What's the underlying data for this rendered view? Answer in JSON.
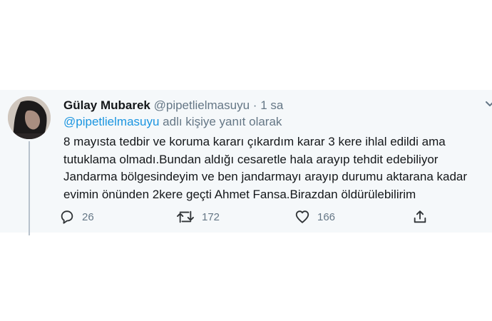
{
  "tweet": {
    "display_name": "Gülay Mubarek",
    "handle": "@pipetlielmasuyu",
    "separator": "·",
    "time": "1 sa",
    "reply_mention": "@pipetlielmasuyu",
    "reply_suffix": "adlı kişiye yanıt olarak",
    "body_lines": [
      "8 mayısta tedbir ve koruma kararı çıkardım karar 3 kere ihlal edildi ama",
      "tutuklama olmadı.Bundan aldığı cesaretle hala arayıp tehdit edebiliyor",
      "Jandarma bölgesindeyim ve ben jandarmayı arayıp durumu aktarana kadar",
      "evimin önünden 2kere geçti Ahmet Fansa.Birazdan öldürülebilirim"
    ],
    "actions": {
      "reply_icon": "reply-icon",
      "reply_count": "26",
      "retweet_icon": "retweet-icon",
      "retweet_count": "172",
      "like_icon": "heart-icon",
      "like_count": "166",
      "share_icon": "share-icon"
    }
  },
  "colors": {
    "background": "#ffffff",
    "tweet_background": "#f5f8fa",
    "text_primary": "#14171a",
    "text_secondary": "#657786",
    "link": "#1b95e0",
    "thread_line": "#b8c2cc"
  }
}
